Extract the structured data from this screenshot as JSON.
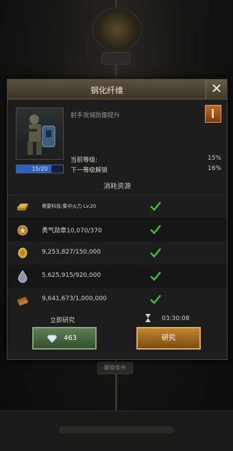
{
  "background": {
    "bottom_pill_label": "解锁条件"
  },
  "dialog": {
    "title": "钢化纤维",
    "close_glyph": "✕",
    "description": "射手攻城防御提升",
    "level_progress_text": "15/20",
    "level_progress_fraction": 0.75,
    "current_level_label": "当前等级:",
    "current_level_value": "15%",
    "next_level_label": "下一等级解锁",
    "next_level_value": "16%",
    "resources_title": "消耗资源",
    "resources": [
      {
        "icon": "gold-bar-icon",
        "text": "需要科技:集中火力 Lv.20"
      },
      {
        "icon": "medal-icon",
        "text": "勇气勋章10,070/370"
      },
      {
        "icon": "food-coin-icon",
        "text": "9,253,827/150,000"
      },
      {
        "icon": "oil-drop-icon",
        "text": "5,625,915/920,000"
      },
      {
        "icon": "wood-icon",
        "text": "9,641,673/1,000,000"
      }
    ],
    "instant_research_label": "立即研究",
    "timer": "03:30:08",
    "instant_cost": "463",
    "research_button": "研究"
  },
  "colors": {
    "accent_gold": "#c4862f",
    "accent_green": "#5e7f56",
    "check_green": "#3fbf3a",
    "progress_blue": "#2f5fc0"
  }
}
